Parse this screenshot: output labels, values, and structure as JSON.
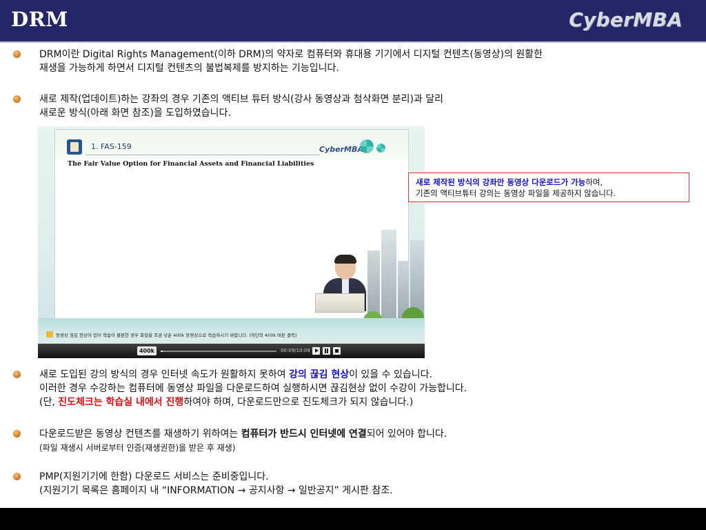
{
  "header": {
    "title": "DRM",
    "brand": "CyberMBA"
  },
  "bullets": {
    "b1": {
      "line1": "DRM이란 Digital Rights Management(이하 DRM)의 약자로 컴퓨터와 휴대용 기기에서 디지털 컨텐츠(동영상)의 원활한",
      "line2": "재생을 가능하게 하면서 디지털 컨텐츠의 불법복제를 방지하는 기능입니다."
    },
    "b2": {
      "line1": "새로 제작(업데이트)하는 강좌의 경우 기존의 액티브 튜터 방식(강사 동영상과 첨삭화면 분리)과 달리",
      "line2": "새로운 방식(아래 화면 참조)을 도입하였습니다."
    },
    "b3": {
      "line1_pre": "새로 도입된 강의 방식의 경우 인터넷 속도가 원활하지 못하여 ",
      "line1_hl": "강의 끊김 현상",
      "line1_post": "이 있을 수 있습니다.",
      "line2": "이러한 경우 수강하는 컴퓨터에 동영상 파일을 다운로드하여 실행하시면 끊김현상 없이 수강이 가능합니다.",
      "line3_pre": "(단, ",
      "line3_hl": "진도체크는 학습실 내에서 진행",
      "line3_post": "하여야 하며, 다운로드만으로 진도체크가 되지 않습니다.)"
    },
    "b4": {
      "line1_pre": "다운로드받은 동영상 컨텐츠를 재생하기 위하여는 ",
      "line1_hl": "컴퓨터가 반드시 인터넷에 연결",
      "line1_post": "되어 있어야 합니다.",
      "line2": "(파일 재생시 서버로부터 인증(재생권한)을 받은 후 재생)"
    },
    "b5": {
      "line1": "PMP(지원기기에 한함) 다운로드 서비스는 준비중입니다.",
      "line2": "(지원기기 목록은 홈페이지 내 “INFORMATION → 공지사항 → 일반공지” 게시판 참조."
    }
  },
  "video": {
    "lesson_title": "1. FAS-159",
    "brand": "CyberMBA",
    "board_heading": "The Fair Value Option for Financial Assets and Financial Liabilities",
    "notice": "동영상 끊김 현상이 있어 학습이 불편한 경우 화질을 조금 낮춘 400k 동영상으로 학습하시기 바랍니다. (하단의 400k 버튼 클릭)",
    "quality_button": "400k",
    "time": "00:09/10:09",
    "progress": 0.02
  },
  "callout": {
    "line1_hl": "새로 제작된 방식의 강좌만 동영상 다운로드가 가능",
    "line1_post": "하며,",
    "line2": "기존의 액티브튜터 강의는 동영상 파일을 제공하지 않습니다."
  },
  "colors": {
    "header_bg": "#232566",
    "highlight_blue": "#1111cc",
    "highlight_red": "#d81010",
    "bullet": "#d9822b",
    "callout_border": "#e03030"
  }
}
